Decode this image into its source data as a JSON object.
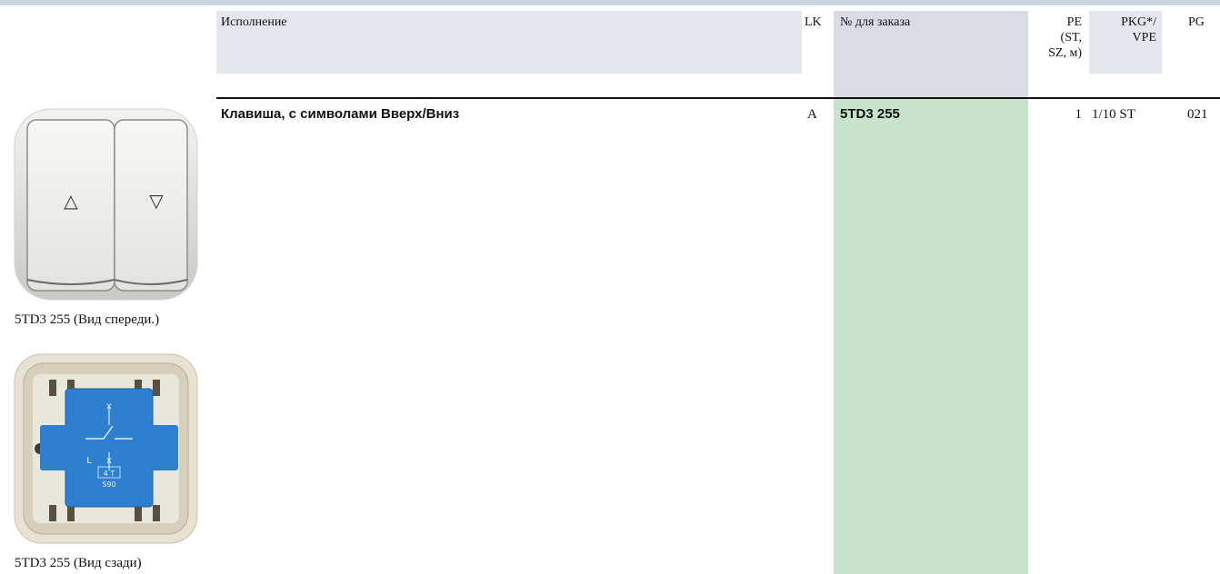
{
  "header": {
    "execution": "Исполнение",
    "lk": "LK",
    "order_no": "№ для заказа",
    "pe_line1": "PE",
    "pe_line2": "(ST,",
    "pe_line3": "SZ, м)",
    "pkg_line1": "PKG*/",
    "pkg_line2": "VPE",
    "pg": "PG"
  },
  "product": {
    "title": "Клавиша, с символами Вверх/Вниз",
    "lk": "A",
    "order_no": "5TD3 255",
    "pe": "1",
    "pkg": "1/10 ST",
    "pg": "021"
  },
  "images": {
    "front_caption": "5TD3 255 (Вид спереди.)",
    "back_caption": "5TD3 255 (Вид сзади)",
    "front_up_symbol": "△",
    "front_down_symbol": "▽",
    "back_label_x1": "x",
    "back_label_x2": "x",
    "back_label_l": "L",
    "back_label_4t": "4 T",
    "back_label_s90": "S90"
  },
  "colors": {
    "accent_green": "#c8e3cc",
    "header_gray": "#e4e8ee",
    "insert_blue": "#2f7fd0"
  }
}
